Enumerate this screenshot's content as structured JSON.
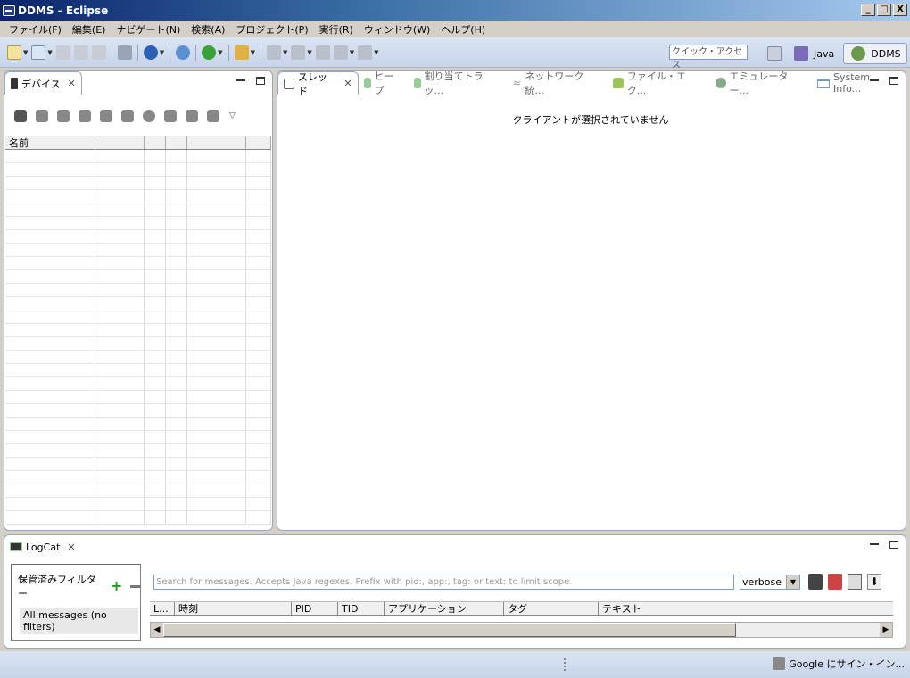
{
  "window": {
    "title": "DDMS - Eclipse",
    "min": "_",
    "max": "□",
    "close": "X"
  },
  "menu": [
    "ファイル(F)",
    "編集(E)",
    "ナビゲート(N)",
    "検索(A)",
    "プロジェクト(P)",
    "実行(R)",
    "ウィンドウ(W)",
    "ヘルプ(H)"
  ],
  "toolbar": {
    "quick_access": "クイック・アクセス"
  },
  "perspectives": {
    "java": "Java",
    "ddms": "DDMS"
  },
  "devices_view": {
    "tab": "デバイス",
    "columns": [
      "名前",
      "",
      "",
      "",
      "",
      ""
    ]
  },
  "main_tabs": [
    {
      "label": "スレッド",
      "active": true
    },
    {
      "label": "ヒープ"
    },
    {
      "label": "割り当てトラッ..."
    },
    {
      "label": "ネットワーク統..."
    },
    {
      "label": "ファイル・エク..."
    },
    {
      "label": "エミュレーター..."
    },
    {
      "label": "System Info..."
    }
  ],
  "main_message": "クライアントが選択されていません",
  "logcat": {
    "tab": "LogCat",
    "saved_filters": "保管済みフィルター",
    "all_messages": "All messages (no filters)",
    "search_placeholder": "Search for messages. Accepts Java regexes. Prefix with pid:, app:, tag: or text: to limit scope.",
    "level": "verbose",
    "columns": [
      "L...",
      "時刻",
      "PID",
      "TID",
      "アプリケーション",
      "タグ",
      "テキスト"
    ]
  },
  "status": {
    "google_sign_in": "Google にサイン・イン..."
  }
}
